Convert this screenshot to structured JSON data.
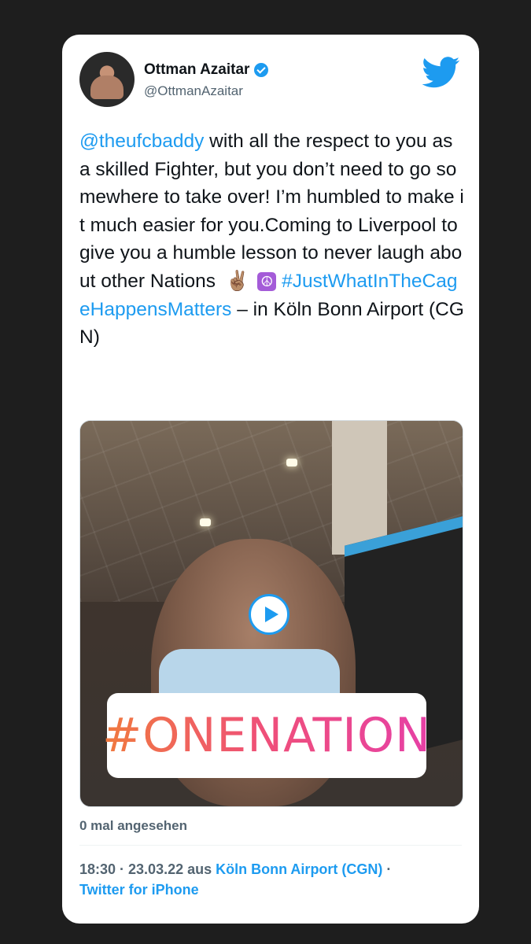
{
  "tweet": {
    "author_name": "Ottman Azaitar",
    "author_handle": "@OttmanAzaitar",
    "mention": "@theufcbaddy",
    "body": " with all the respect to you as a skilled Fighter, but you don’t need to go somewhere to take over! I’m humbled to make it much easier for you.Coming to Liverpool to give you a humble lesson to never laugh about other Nations",
    "emoji_1": "✌🏽",
    "emoji_2": "☮",
    "hashtag": "#JustWhatInTheCageHappensMatters",
    "location_suffix": " – in Köln Bonn Airport (CGN)"
  },
  "media": {
    "sticker_text": "#ONENATION",
    "play_icon": "play-icon"
  },
  "stats": {
    "views": "0 mal angesehen"
  },
  "meta": {
    "time_date": "18:30 · 23.03.22 aus ",
    "place": "Köln Bonn Airport (CGN)",
    "separator": " ·",
    "client": "Twitter for iPhone"
  },
  "colors": {
    "accent": "#1d9bf0",
    "background": "#1e1e1e",
    "card": "#ffffff"
  }
}
